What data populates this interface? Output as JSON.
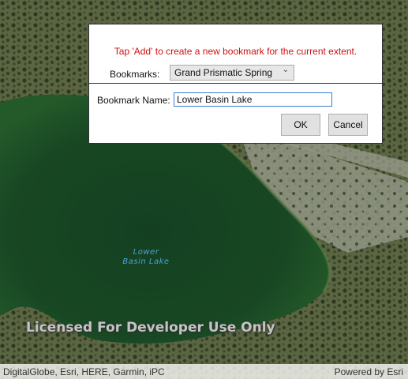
{
  "dialog": {
    "instruction": "Tap 'Add' to create a new bookmark for the current extent.",
    "bookmarks_label": "Bookmarks:",
    "bookmarks_selected": "Grand Prismatic Spring",
    "chevron_icon": "chevron-down-icon",
    "name_label": "Bookmark Name:",
    "name_value": "Lower Basin Lake",
    "ok_label": "OK",
    "cancel_label": "Cancel",
    "instruction_color": "#d01010"
  },
  "map": {
    "lake_label_line1": "Lower",
    "lake_label_line2": "Basin Lake",
    "watermark": "Licensed For Developer Use Only",
    "attribution_left": "DigitalGlobe, Esri, HERE, Garmin, iPC",
    "attribution_right": "Powered by Esri"
  }
}
